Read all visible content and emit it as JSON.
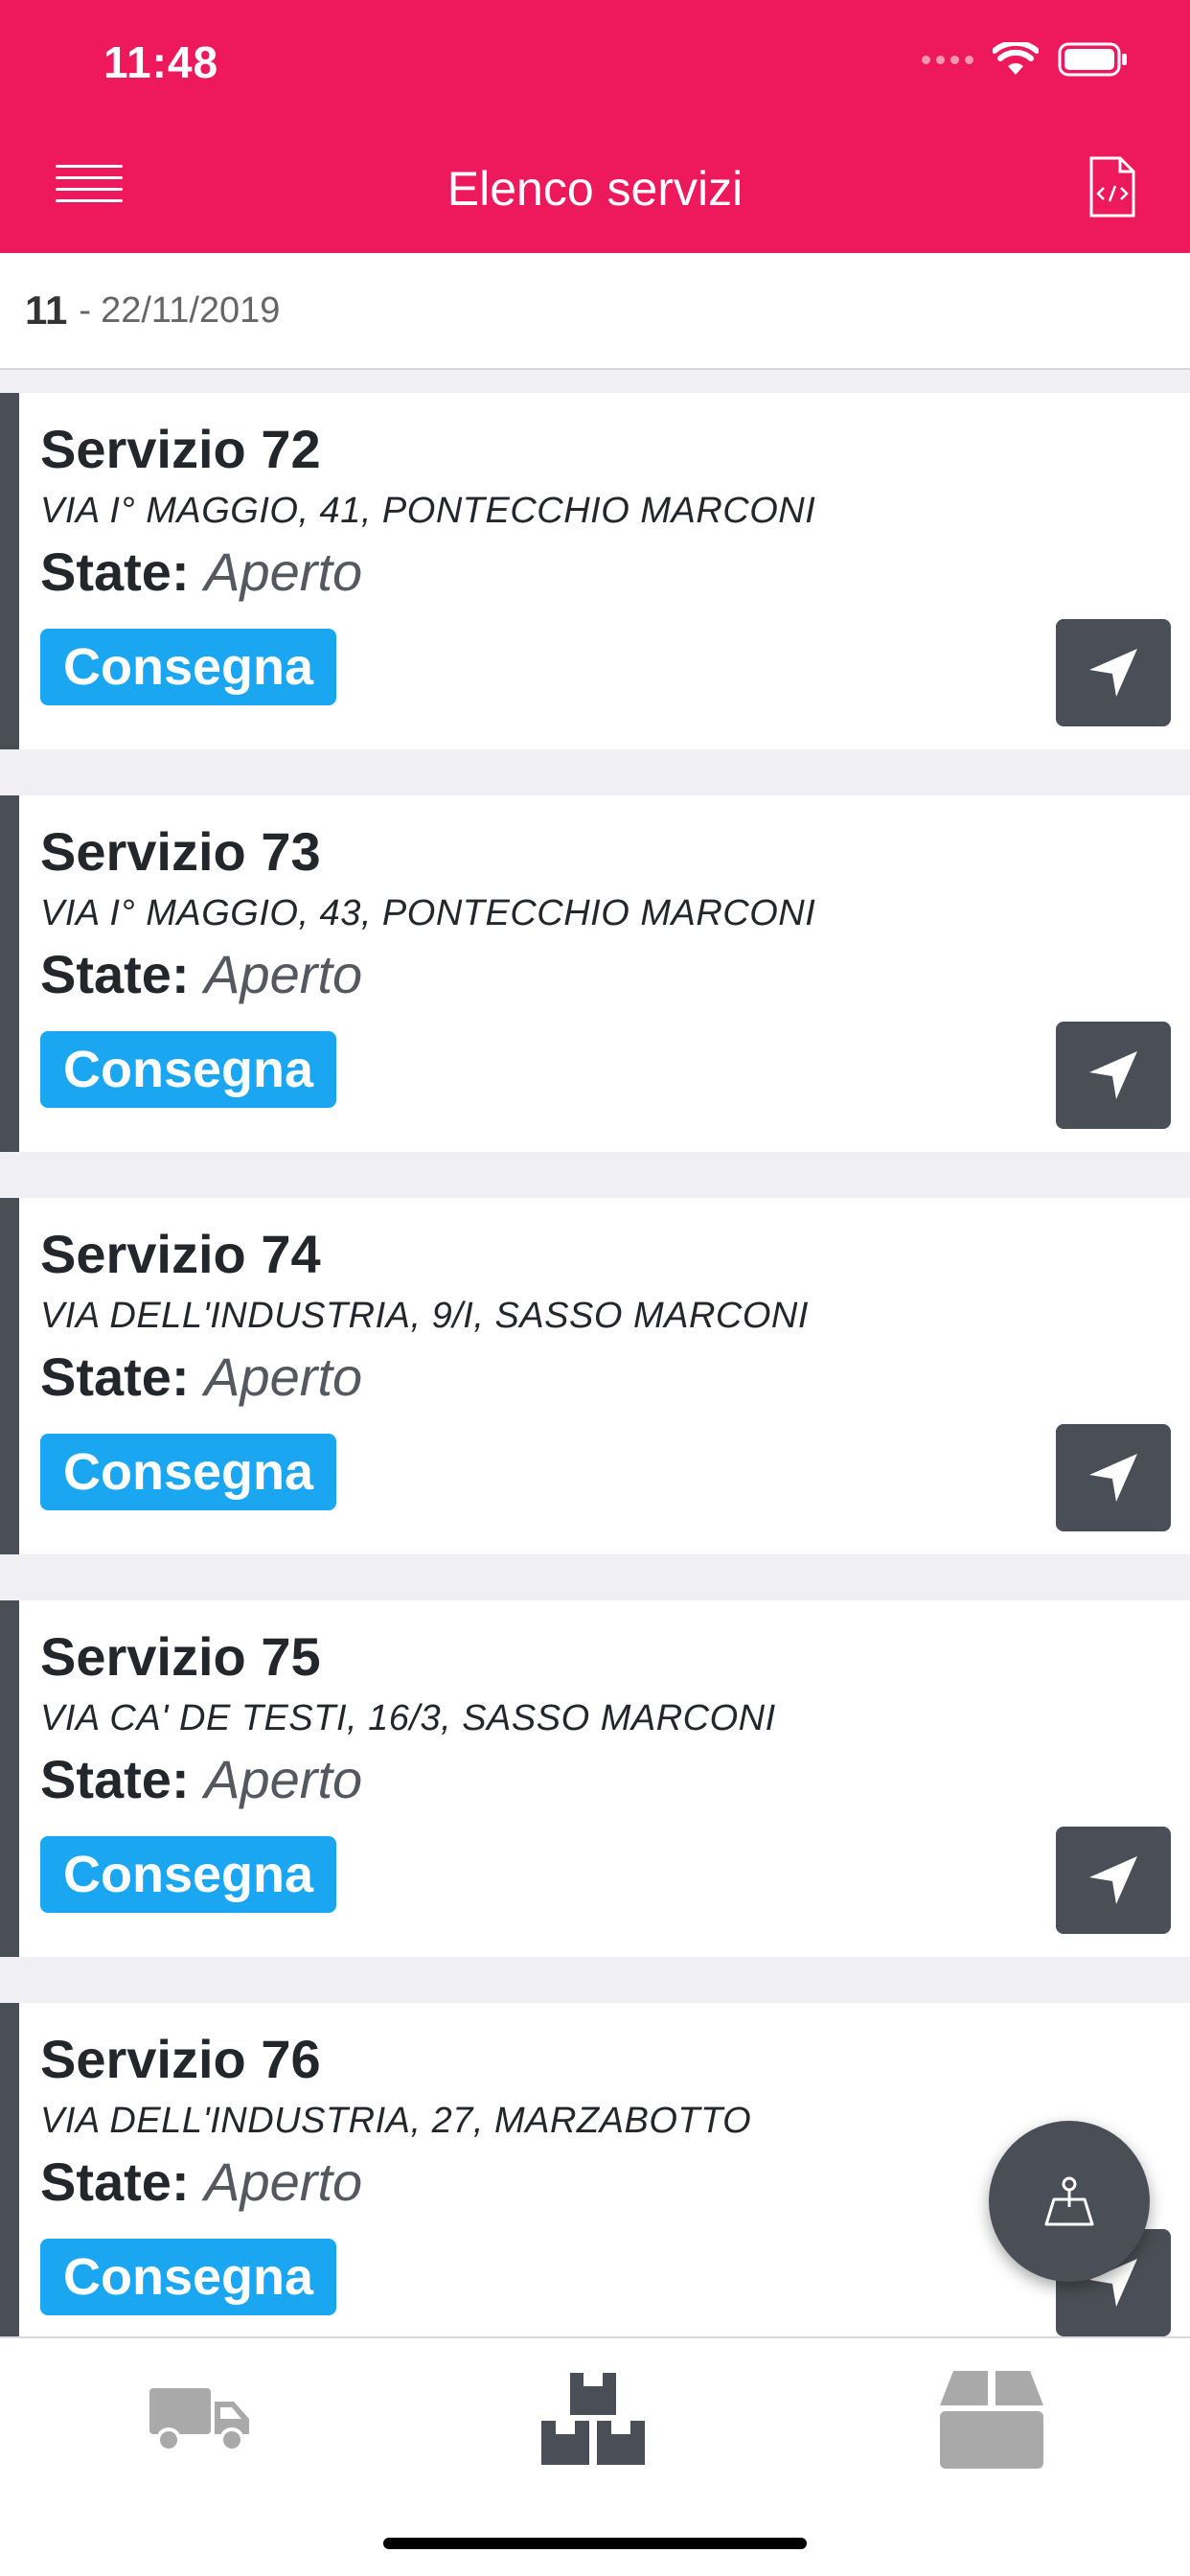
{
  "status_bar": {
    "time": "11:48"
  },
  "header": {
    "title": "Elenco servizi",
    "menu_icon": "hamburger-menu-icon",
    "right_icon": "code-file-icon"
  },
  "date_bar": {
    "day": "11",
    "separator": "-",
    "date": "22/11/2019"
  },
  "services": [
    {
      "title": "Servizio 72",
      "address": "VIA I° MAGGIO, 41, PONTECCHIO MARCONI",
      "state_label": "State:",
      "state": "Aperto",
      "type": "Consegna"
    },
    {
      "title": "Servizio 73",
      "address": "VIA I° MAGGIO, 43, PONTECCHIO MARCONI",
      "state_label": "State:",
      "state": "Aperto",
      "type": "Consegna"
    },
    {
      "title": "Servizio 74",
      "address": "VIA DELL'INDUSTRIA, 9/I, SASSO MARCONI",
      "state_label": "State:",
      "state": "Aperto",
      "type": "Consegna"
    },
    {
      "title": "Servizio 75",
      "address": "VIA CA' DE TESTI, 16/3, SASSO MARCONI",
      "state_label": "State:",
      "state": "Aperto",
      "type": "Consegna"
    },
    {
      "title": "Servizio 76",
      "address": "VIA DELL'INDUSTRIA, 27, MARZABOTTO",
      "state_label": "State:",
      "state": "Aperto",
      "type": "Consegna"
    }
  ],
  "tab_bar": {
    "tabs": [
      "truck-icon",
      "stacked-boxes-icon",
      "package-icon"
    ],
    "active_index": 1
  },
  "fab": {
    "icon": "map-pin-icon"
  },
  "colors": {
    "header": "#ee185c",
    "badge": "#1aa6f0",
    "dark": "#4a4f57"
  }
}
